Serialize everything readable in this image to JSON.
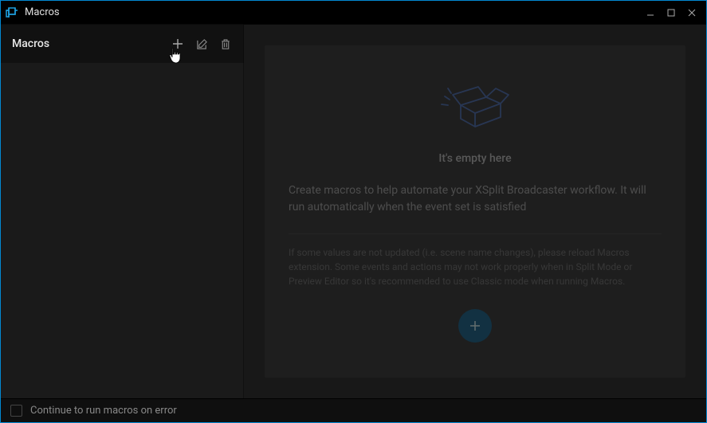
{
  "window": {
    "title": "Macros"
  },
  "sidebar": {
    "title": "Macros"
  },
  "main": {
    "empty_heading": "It's empty here",
    "empty_description": "Create macros to help automate your XSplit Broadcaster workflow. It will run automatically when the event set is satisfied",
    "note": "If some values are not updated (i.e. scene name changes), please reload Macros extension. Some events and actions may not work properly when in Split Mode or Preview Editor so it's recommended to use Classic mode when running Macros."
  },
  "footer": {
    "checkbox_label": "Continue to run macros on error",
    "checkbox_checked": false
  }
}
